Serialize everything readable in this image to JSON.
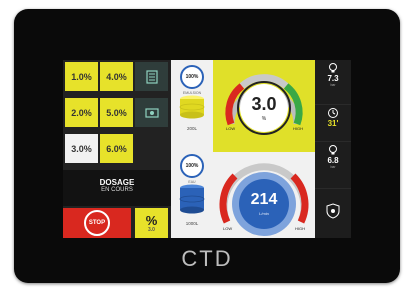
{
  "brand": "CTD",
  "tiles": [
    {
      "label": "1.0%",
      "style": "yellow"
    },
    {
      "label": "4.0%",
      "style": "yellow"
    },
    {
      "label": "2.0%",
      "style": "yellow"
    },
    {
      "label": "5.0%",
      "style": "yellow"
    },
    {
      "label": "3.0%",
      "style": "white"
    },
    {
      "label": "6.0%",
      "style": "yellow"
    }
  ],
  "dosage": {
    "title": "DOSAGE",
    "subtitle": "EN COURS"
  },
  "stop": {
    "label": "STOP"
  },
  "pct_button": {
    "symbol": "%",
    "value": "3.0"
  },
  "tanks": [
    {
      "percent": "100%",
      "label": "EMULSION",
      "volume": "200L"
    },
    {
      "percent": "100%",
      "label": "EAU",
      "volume": "1000L"
    }
  ],
  "gauge_concentration": {
    "value": "3.0",
    "unit": "%",
    "low": "LOW",
    "high": "HIGH"
  },
  "gauge_flow": {
    "value": "214",
    "unit": "L/min",
    "low": "LOW",
    "high": "HIGH"
  },
  "readouts": {
    "pressure_top": "7.3",
    "pressure_top_unit": "bar",
    "timer": "31'",
    "pressure_bottom": "6.8",
    "pressure_bottom_unit": "bar"
  },
  "colors": {
    "yellow": "#e7e22a",
    "stop_red": "#d9281f",
    "tank_blue": "#2b62b8",
    "gauge_blue": "#7ea3dc"
  }
}
